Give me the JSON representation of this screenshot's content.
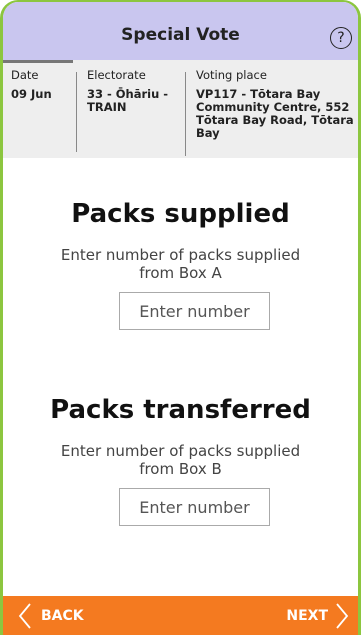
{
  "header": {
    "title": "Special Vote",
    "help_glyph": "?",
    "accent_color": "#c9c6ef",
    "frame_color": "#8cc63f"
  },
  "info": {
    "date_label": "Date",
    "date_value": "09 Jun",
    "electorate_label": "Electorate",
    "electorate_value_line1": "33 - Ōhāriu -",
    "electorate_value_line2": "TRAIN",
    "voting_place_label": "Voting place",
    "voting_place_lines": [
      "VP117 - Tōtara Bay",
      "Community Centre, 552",
      "Tōtara Bay Road, Tōtara",
      "Bay"
    ]
  },
  "supplied": {
    "title": "Packs supplied",
    "desc_line1": "Enter number of packs supplied",
    "desc_line2": "from Box A",
    "placeholder": "Enter number"
  },
  "transferred": {
    "title": "Packs transferred",
    "desc_line1": "Enter number of packs supplied",
    "desc_line2": "from Box B",
    "placeholder": "Enter number"
  },
  "footer": {
    "back_label": "BACK",
    "next_label": "NEXT",
    "color": "#f47a20",
    "back_icon": "chevron-left-icon",
    "next_icon": "chevron-right-icon"
  }
}
